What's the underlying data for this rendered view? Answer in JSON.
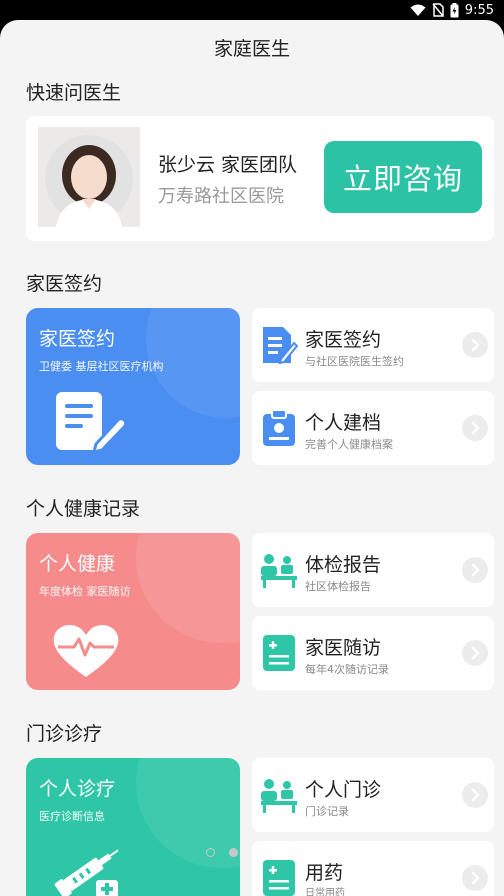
{
  "status": {
    "time": "9:55"
  },
  "page": {
    "title": "家庭医生"
  },
  "quick": {
    "section_title": "快速问医生",
    "doctor_name": "张少云 家医团队",
    "hospital": "万寿路社区医院",
    "consult_label": "立即咨询"
  },
  "sign": {
    "section_title": "家医签约",
    "big": {
      "title": "家医签约",
      "subtitle": "卫健委 基层社区医疗机构",
      "icon": "document-pen-icon"
    },
    "items": [
      {
        "title": "家医签约",
        "subtitle": "与社区医院医生签约",
        "icon": "sign-contract-icon"
      },
      {
        "title": "个人建档",
        "subtitle": "完善个人健康档案",
        "icon": "clipboard-icon"
      }
    ]
  },
  "health": {
    "section_title": "个人健康记录",
    "big": {
      "title": "个人健康",
      "subtitle": "年度体检 家医随访",
      "icon": "heart-pulse-icon"
    },
    "items": [
      {
        "title": "体检报告",
        "subtitle": "社区体检报告",
        "icon": "patient-bed-icon"
      },
      {
        "title": "家医随访",
        "subtitle": "每年4次随访记录",
        "icon": "calculator-icon"
      }
    ]
  },
  "clinic": {
    "section_title": "门诊诊疗",
    "big": {
      "title": "个人诊疗",
      "subtitle": "医疗诊断信息",
      "icon": "syringe-icon"
    },
    "items": [
      {
        "title": "个人门诊",
        "subtitle": "门诊记录",
        "icon": "patient-bed-icon"
      },
      {
        "title": "用药",
        "subtitle": "日常用药",
        "icon": "calculator-icon"
      }
    ]
  },
  "colors": {
    "accent": "#2cc2a5",
    "blue": "#4a8ef2",
    "pink": "#f58b8b",
    "teal": "#2ec6a7"
  }
}
